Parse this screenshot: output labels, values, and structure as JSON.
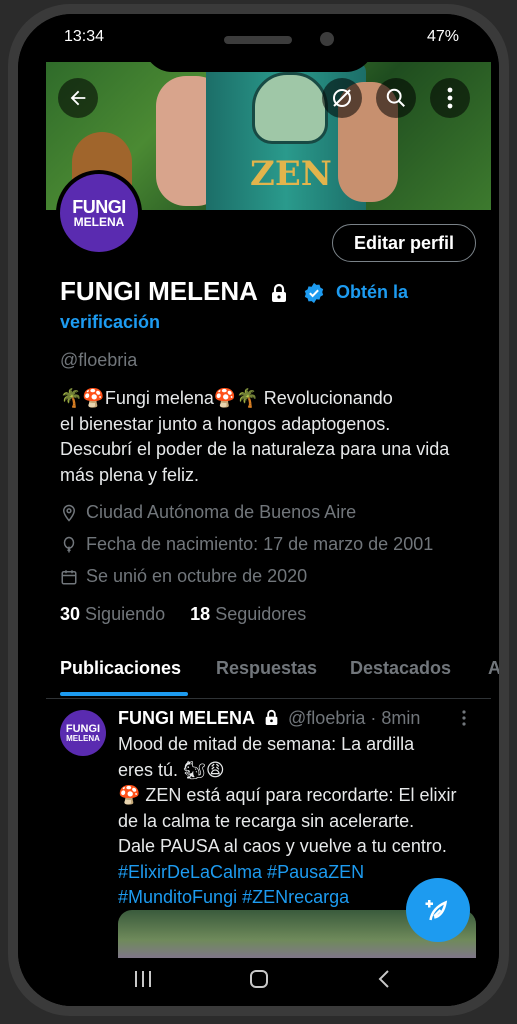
{
  "status": {
    "time": "13:34",
    "right": "47%"
  },
  "banner": {
    "can_text": "ZEN"
  },
  "profile": {
    "avatar_line1": "FUNGI",
    "avatar_line2": "MELENA",
    "edit_label": "Editar perfil",
    "name": "FUNGI MELENA",
    "verify_line1": "Obtén la",
    "verify_line2": "verificación",
    "handle": "@floebria",
    "bio_line1": "🌴🍄Fungi melena🍄🌴 Revolucionando",
    "bio_line2": "el bienestar junto a hongos adaptogenos.",
    "bio_line3": "Descubrí el poder de la naturaleza para una vida",
    "bio_line4": "más plena y feliz.",
    "location": "Ciudad Autónoma de Buenos Aire",
    "birthday": "Fecha de nacimiento: 17 de marzo de 2001",
    "joined": "Se unió en octubre de 2020",
    "following_count": "30",
    "following_label": "Siguiendo",
    "followers_count": "18",
    "followers_label": "Seguidores"
  },
  "tabs": [
    "Publicaciones",
    "Respuestas",
    "Destacados",
    "A"
  ],
  "tweet": {
    "name": "FUNGI MELENA",
    "handle_time": "@floebria · 8min",
    "line1": "Mood de mitad de semana: La ardilla",
    "line2": "eres tú. 🐿😩",
    "line3": "🍄 ZEN está aquí para recordarte:  El elixir",
    "line4": "de la calma te recarga sin acelerarte.",
    "line5": "Dale PAUSA al caos y vuelve a tu centro.",
    "tags1": "#ElixirDeLaCalma #PausaZEN",
    "tags2": "#MunditoFungi #ZENrecarga"
  },
  "colors": {
    "accent": "#1d9bf0",
    "avatar": "#5a2bb0"
  }
}
